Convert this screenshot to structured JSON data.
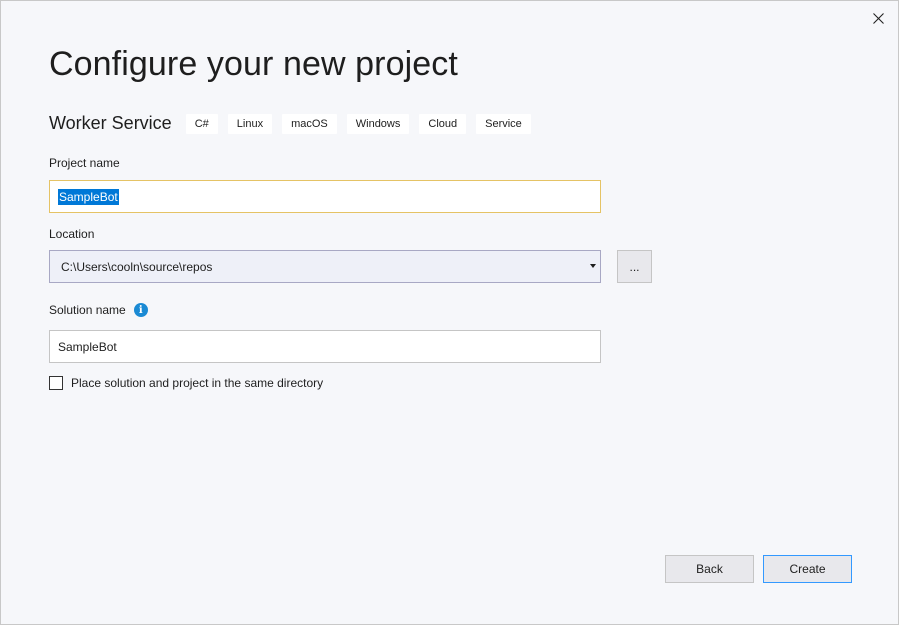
{
  "dialog": {
    "title": "Configure your new project",
    "close_icon": "close-icon"
  },
  "template": {
    "name": "Worker Service",
    "tags": [
      "C#",
      "Linux",
      "macOS",
      "Windows",
      "Cloud",
      "Service"
    ]
  },
  "project_name": {
    "label": "Project name",
    "value": "SampleBot"
  },
  "location": {
    "label": "Location",
    "value": "C:\\Users\\cooln\\source\\repos",
    "browse_label": "..."
  },
  "solution_name": {
    "label": "Solution name",
    "info_icon": "info-icon",
    "value": "SampleBot"
  },
  "same_directory": {
    "label": "Place solution and project in the same directory",
    "checked": false
  },
  "footer": {
    "back_label": "Back",
    "create_label": "Create"
  },
  "colors": {
    "accent": "#0078d7",
    "focus_border": "#e5c365",
    "primary_border": "#3399ff",
    "info_blue": "#1a8ad4"
  }
}
